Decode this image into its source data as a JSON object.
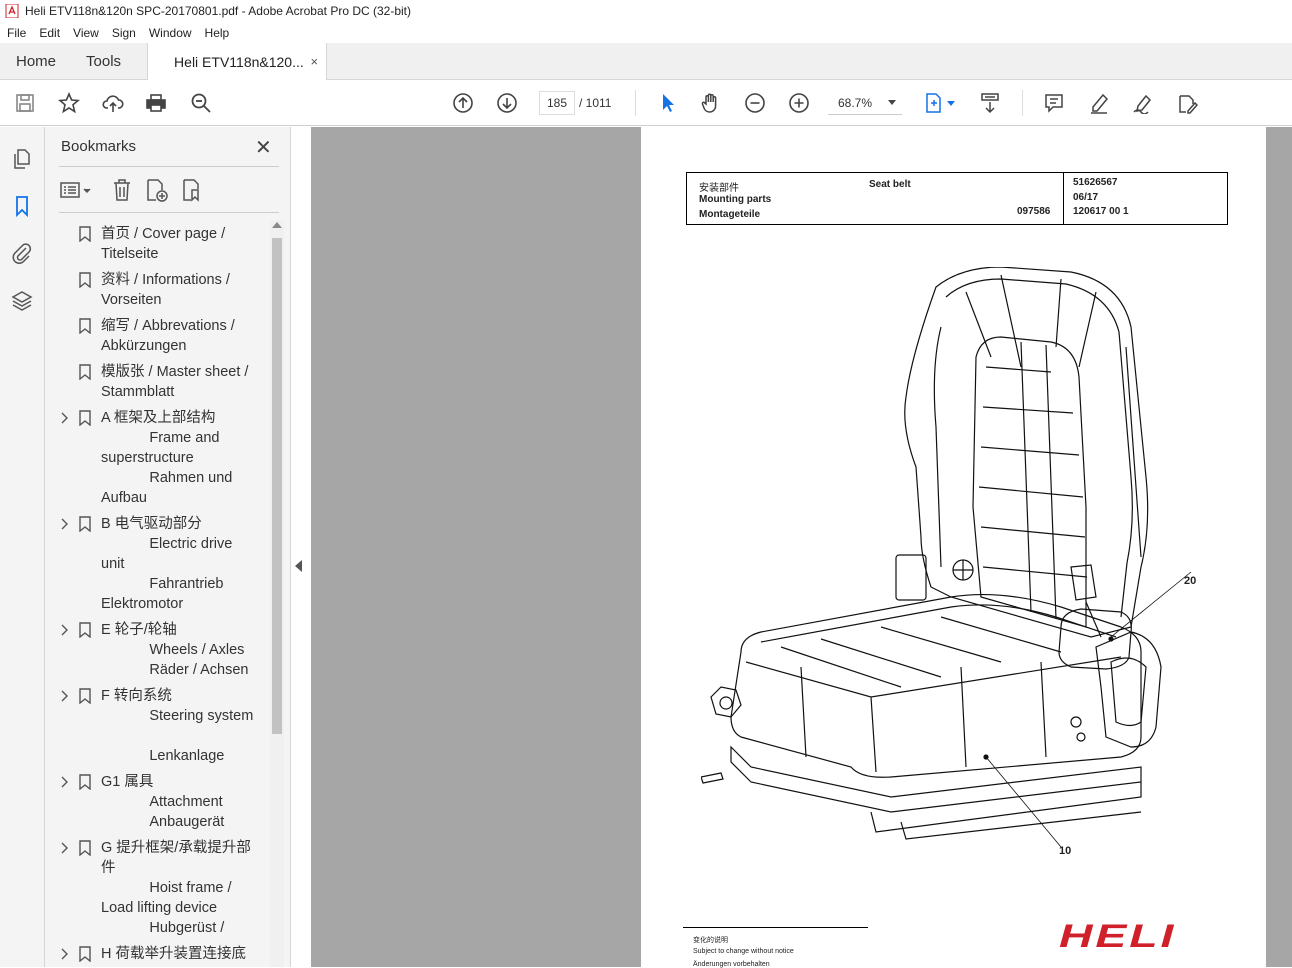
{
  "window": {
    "title": "Heli ETV118n&120n SPC-20170801.pdf - Adobe Acrobat Pro DC (32-bit)"
  },
  "menu": [
    "File",
    "Edit",
    "View",
    "Sign",
    "Window",
    "Help"
  ],
  "tabs": {
    "home": "Home",
    "tools": "Tools",
    "document": "Heli ETV118n&120...",
    "close": "×"
  },
  "toolbar": {
    "page_current": "185",
    "page_total": "/ 1011",
    "zoom": "68.7%"
  },
  "bookmarks": {
    "title": "Bookmarks",
    "close": "✕",
    "items": [
      {
        "label": "首页 / Cover page /\nTitelseite",
        "expandable": false
      },
      {
        "label": "资料 / Informations /\nVorseiten",
        "expandable": false
      },
      {
        "label": "缩写 / Abbrevations /\nAbkürzungen",
        "expandable": false
      },
      {
        "label": "模版张 / Master sheet /\nStammblatt",
        "expandable": false
      },
      {
        "label": "A 框架及上部结构\n            Frame and\nsuperstructure\n            Rahmen und\nAufbau",
        "expandable": true
      },
      {
        "label": "B 电气驱动部分\n            Electric drive\nunit\n            Fahrantrieb\nElektromotor",
        "expandable": true
      },
      {
        "label": "E 轮子/轮轴\n            Wheels / Axles\n            Räder / Achsen",
        "expandable": true
      },
      {
        "label": "F 转向系统\n            Steering system\n\n            Lenkanlage",
        "expandable": true
      },
      {
        "label": "G1 属具\n            Attachment\n            Anbaugerät",
        "expandable": true
      },
      {
        "label": "G 提升框架/承载提升部\n件\n            Hoist frame /\nLoad lifting device\n            Hubgerüst /",
        "expandable": true
      },
      {
        "label": "H 荷载举升装置连接底",
        "expandable": true
      }
    ]
  },
  "pdf_page": {
    "header": {
      "cn": "安装部件",
      "en": "Mounting parts",
      "de": "Montageteile",
      "title": "Seat belt",
      "drawing_no": "097586",
      "part_no": "51626567",
      "date": "06/17",
      "code": "120617 00 1"
    },
    "callouts": {
      "a": "20",
      "b": "10"
    },
    "footer": {
      "cn": "变化的说明",
      "en": "Subject to change without notice",
      "de": "Änderungen vorbehalten"
    },
    "brand": "HELI"
  },
  "colors": {
    "brand_red": "#d0202a",
    "viewer_bg": "#a6a6a6",
    "accent_blue": "#1473e6"
  }
}
